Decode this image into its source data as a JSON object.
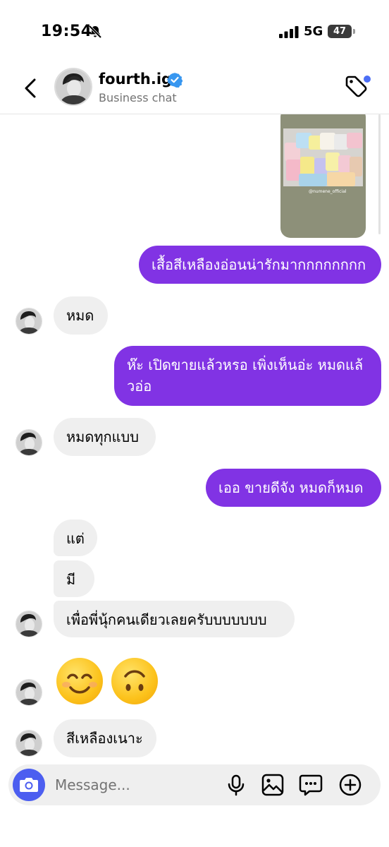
{
  "status_bar": {
    "time": "19:54",
    "network": "5G",
    "battery": "47"
  },
  "header": {
    "name": "fourth.ig",
    "subtitle": "Business chat"
  },
  "shared_post": {
    "caption": "@numene_official"
  },
  "messages": [
    {
      "side": "out",
      "text": "เสื้อสีเหลืองอ่อนน่ารักมากกกกกกกก"
    },
    {
      "side": "in",
      "text": "หมด"
    },
    {
      "side": "out",
      "text": "ห๊ะ เปิดขายแล้วหรอ เพิ่งเห็นอ่ะ หมดแล้วอ่อ"
    },
    {
      "side": "in",
      "text": "หมดทุกแบบ"
    },
    {
      "side": "out",
      "text": "เออ ขายดีจัง หมดก็หมด"
    },
    {
      "side": "in",
      "text": "แต่"
    },
    {
      "side": "in",
      "text": "มี"
    },
    {
      "side": "in",
      "text": "เพื่อพี่นุ้กคนเดียวเลยครับบบบบบบ"
    },
    {
      "side": "in",
      "emoji": [
        "smiling-face-icon",
        "upside-down-face-icon"
      ]
    },
    {
      "side": "in",
      "text": "สีเหลืองเนาะ"
    }
  ],
  "composer": {
    "placeholder": "Message..."
  },
  "colors": {
    "outgoing_bubble": "#8133e4",
    "incoming_bubble": "#efefef",
    "camera_button": "#4c5ef0",
    "verified": "#3897f0",
    "tag_dot": "#4c6ef5"
  }
}
